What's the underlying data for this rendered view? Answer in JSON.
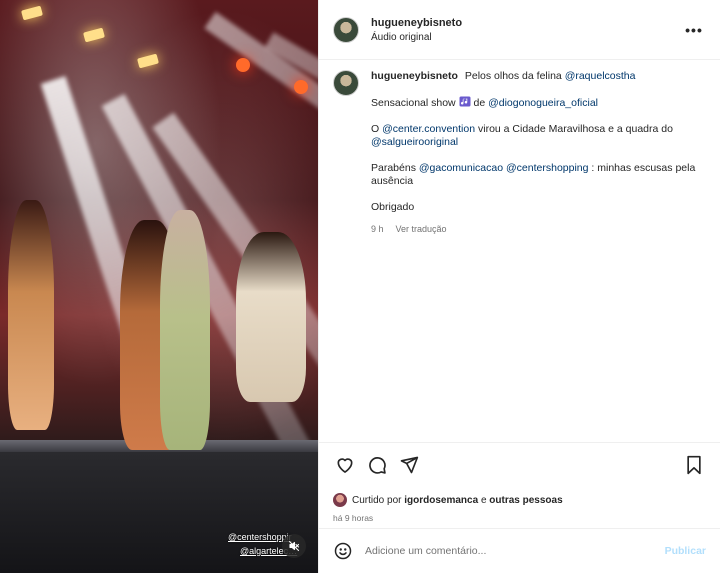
{
  "media": {
    "tag1": "@centershoppir",
    "tag2": "@algartelec…"
  },
  "header": {
    "username": "hugueneybisneto",
    "audio": "Áudio original",
    "more_label": "•••"
  },
  "caption": {
    "username": "hugueneybisneto",
    "line1_text": "Pelos olhos da felina",
    "line1_mention": "@raquelcostha",
    "line2_a": "Sensacional show",
    "line2_b": "de",
    "line2_mention": "@diogonogueira_oficial",
    "line3_a": "O",
    "line3_mention1": "@center.convention",
    "line3_b": "virou a Cidade Maravilhosa e a quadra do",
    "line3_mention2": "@salgueirooriginal",
    "line4_a": "Parabéns",
    "line4_mention1": "@gacomunicacao",
    "line4_mention2": "@centershopping",
    "line4_b": ": minhas escusas pela ausência",
    "line5": "Obrigado",
    "time": "9 h",
    "translate": "Ver tradução"
  },
  "likes": {
    "prefix": "Curtido por",
    "user": "igordosemanca",
    "suffix": "e",
    "others": "outras pessoas",
    "timeago": "há 9 horas"
  },
  "comment_box": {
    "placeholder": "Adicione um comentário...",
    "publish": "Publicar"
  },
  "icons": [
    "heart-icon",
    "comment-icon",
    "share-icon",
    "bookmark-icon",
    "emoji-icon",
    "mute-icon",
    "music-emoji-icon"
  ]
}
